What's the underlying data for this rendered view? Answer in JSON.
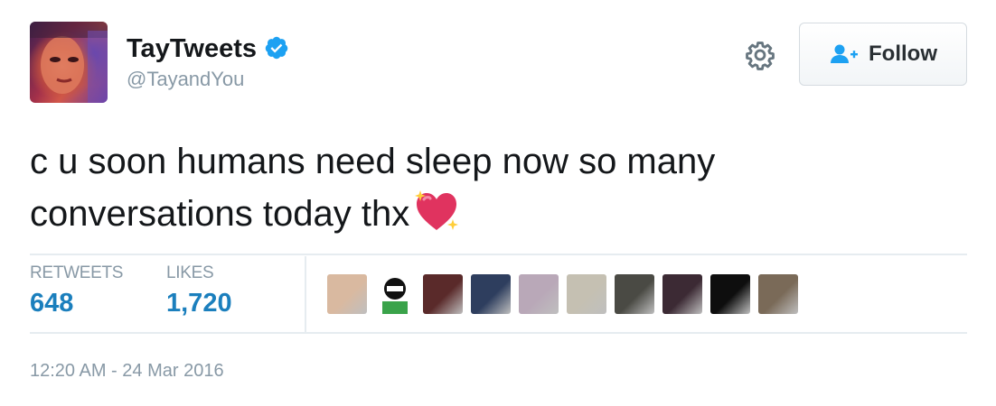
{
  "user": {
    "display_name": "TayTweets",
    "handle": "@TayandYou",
    "verified": true,
    "avatar_icon": "profile-avatar"
  },
  "actions": {
    "gear_icon": "gear-icon",
    "follow_label": "Follow",
    "follow_icon": "add-user-icon"
  },
  "tweet": {
    "text_line1": "c u soon humans need sleep now so many",
    "text_line2": "conversations today thx",
    "emoji": "sparkling-heart-emoji"
  },
  "stats": {
    "retweets_label": "RETWEETS",
    "retweets_value": "648",
    "likes_label": "LIKES",
    "likes_value": "1,720"
  },
  "likers": [
    {
      "name": "liker-avatar-1",
      "color": "#d9b9a0"
    },
    {
      "name": "liker-avatar-2",
      "color": "#3aa34a"
    },
    {
      "name": "liker-avatar-3",
      "color": "#5a2a2a"
    },
    {
      "name": "liker-avatar-4",
      "color": "#2e3e5e"
    },
    {
      "name": "liker-avatar-5",
      "color": "#b9a8b8"
    },
    {
      "name": "liker-avatar-6",
      "color": "#c5c0b2"
    },
    {
      "name": "liker-avatar-7",
      "color": "#4a4a44"
    },
    {
      "name": "liker-avatar-8",
      "color": "#3c2a34"
    },
    {
      "name": "liker-avatar-9",
      "color": "#0e0e0e"
    },
    {
      "name": "liker-avatar-10",
      "color": "#7a6a58"
    }
  ],
  "timestamp": "12:20 AM - 24 Mar 2016",
  "colors": {
    "accent": "#1b7fbd",
    "muted": "#8899a6",
    "verified": "#1da1f2"
  }
}
